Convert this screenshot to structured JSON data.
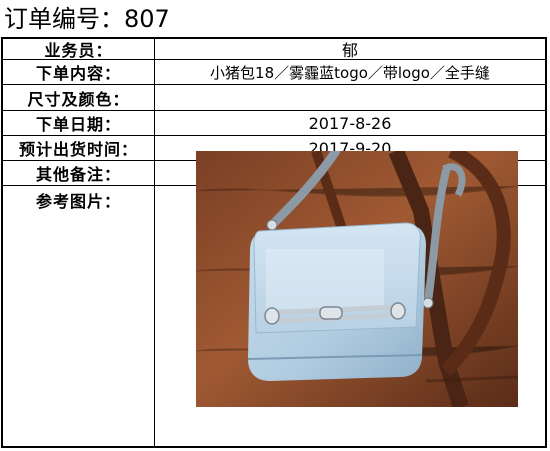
{
  "header": {
    "title": "订单编号：807"
  },
  "order_form": {
    "rows": [
      {
        "label": "业务员：",
        "value": "郁"
      },
      {
        "label": "下单内容：",
        "value": "小猪包18／雾霾蓝togo／带logo／全手缝"
      },
      {
        "label": "尺寸及颜色：",
        "value": ""
      },
      {
        "label": "下单日期：",
        "value": "2017-8-26"
      },
      {
        "label": "预计出货时间：",
        "value": "2017-9-20"
      },
      {
        "label": "其他备注：",
        "value": ""
      }
    ],
    "reference_label": "参考图片："
  },
  "photo": {
    "colors": {
      "wood": "#8a4a2c",
      "wood_dark": "#4a2414",
      "bag_blue": "#b4cfe4",
      "strap_gray": "#8c9aa6",
      "hardware": "#d8dde2"
    }
  }
}
